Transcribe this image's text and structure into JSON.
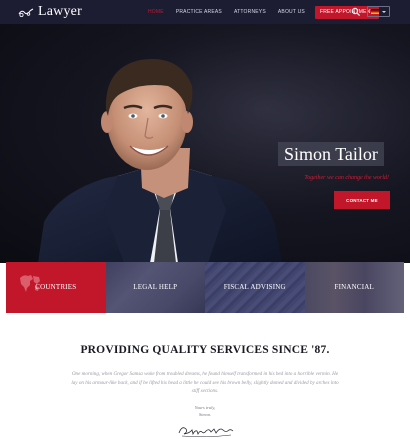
{
  "header": {
    "logo_text": "Lawyer",
    "nav": [
      "HOME",
      "PRACTICE AREAS",
      "ATTORNEYS",
      "ABOUT US"
    ],
    "appointment_label": "FREE APPOINTMENT",
    "search_icon": "search-icon",
    "language_flag": "german-flag-icon",
    "colors": {
      "bar": "#1c1d33",
      "accent": "#c2172b"
    }
  },
  "hero": {
    "title": "Simon Tailor",
    "subtitle": "Together we can change the world!",
    "button_label": "CONTACT ME"
  },
  "services": [
    {
      "label": "COUNTRIES",
      "icon": "world-map-icon",
      "active": true
    },
    {
      "label": "LEGAL HELP"
    },
    {
      "label": "FISCAL ADVISING"
    },
    {
      "label": "FINANCIAL"
    }
  ],
  "content": {
    "title": "PROVIDING QUALITY SERVICES SINCE '87.",
    "body": "One morning, when Gregor Samsa woke from troubled dreams, he found himself transformed in his bed into a horrible vermin. He lay on his armour-like back, and if he lifted his head a little he could see his brown belly, slightly domed and divided by arches into stiff sections.",
    "closing": "Yours truly,",
    "signer": "Simon.",
    "signature": "Simon Tailor"
  }
}
